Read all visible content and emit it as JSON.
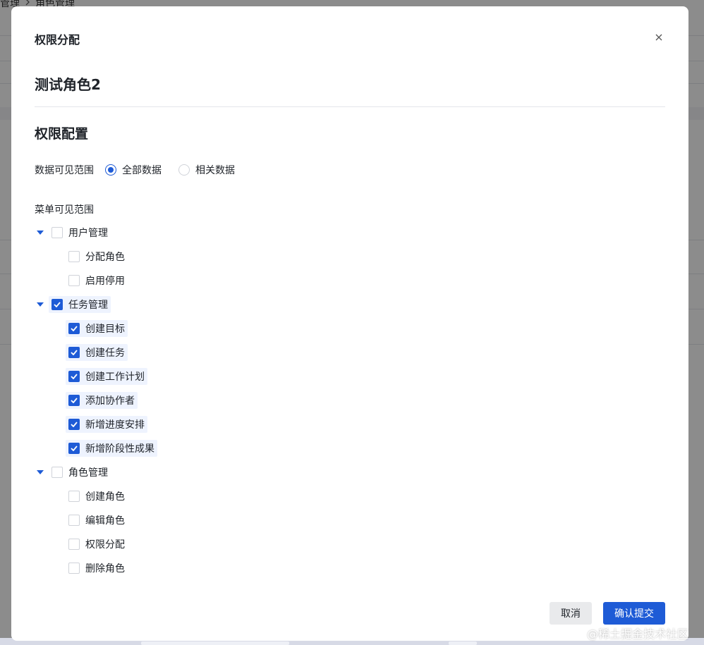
{
  "background": {
    "breadcrumb": [
      "管理",
      "角色管理"
    ]
  },
  "modal": {
    "title": "权限分配",
    "role_name": "测试角色2",
    "section_title": "权限配置",
    "data_scope": {
      "label": "数据可见范围",
      "options": [
        {
          "label": "全部数据",
          "selected": true
        },
        {
          "label": "相关数据",
          "selected": false
        }
      ]
    },
    "menu_scope_label": "菜单可见范围",
    "tree": [
      {
        "label": "用户管理",
        "checked": false,
        "expanded": true,
        "children": [
          {
            "label": "分配角色",
            "checked": false
          },
          {
            "label": "启用停用",
            "checked": false
          }
        ]
      },
      {
        "label": "任务管理",
        "checked": true,
        "expanded": true,
        "children": [
          {
            "label": "创建目标",
            "checked": true
          },
          {
            "label": "创建任务",
            "checked": true
          },
          {
            "label": "创建工作计划",
            "checked": true
          },
          {
            "label": "添加协作者",
            "checked": true
          },
          {
            "label": "新增进度安排",
            "checked": true
          },
          {
            "label": "新增阶段性成果",
            "checked": true
          }
        ]
      },
      {
        "label": "角色管理",
        "checked": false,
        "expanded": true,
        "children": [
          {
            "label": "创建角色",
            "checked": false
          },
          {
            "label": "编辑角色",
            "checked": false
          },
          {
            "label": "权限分配",
            "checked": false
          },
          {
            "label": "删除角色",
            "checked": false
          }
        ]
      }
    ],
    "buttons": {
      "cancel": "取消",
      "confirm": "确认提交"
    }
  },
  "watermark": "@稀土掘金技术社区",
  "colors": {
    "primary": "#1e5bd6",
    "checked_bg": "#eef3fe",
    "text": "#1f2329"
  }
}
